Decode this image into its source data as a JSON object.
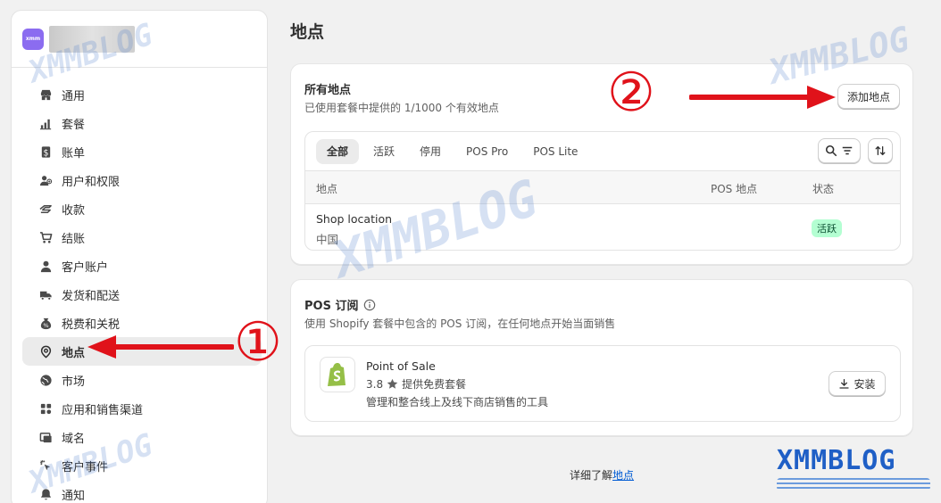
{
  "store": {
    "logo_text": "xmm"
  },
  "sidebar": {
    "items": [
      {
        "label": "通用",
        "icon": "store-icon"
      },
      {
        "label": "套餐",
        "icon": "plan-chart-icon"
      },
      {
        "label": "账单",
        "icon": "billing-icon"
      },
      {
        "label": "用户和权限",
        "icon": "users-icon"
      },
      {
        "label": "收款",
        "icon": "payments-icon"
      },
      {
        "label": "结账",
        "icon": "cart-icon"
      },
      {
        "label": "客户账户",
        "icon": "person-icon"
      },
      {
        "label": "发货和配送",
        "icon": "truck-icon"
      },
      {
        "label": "税费和关税",
        "icon": "tax-icon"
      },
      {
        "label": "地点",
        "icon": "location-pin-icon",
        "active": true
      },
      {
        "label": "市场",
        "icon": "globe-icon"
      },
      {
        "label": "应用和销售渠道",
        "icon": "apps-icon"
      },
      {
        "label": "域名",
        "icon": "domain-icon"
      },
      {
        "label": "客户事件",
        "icon": "cursor-icon"
      },
      {
        "label": "通知",
        "icon": "bell-icon"
      }
    ]
  },
  "page": {
    "title": "地点"
  },
  "locations_card": {
    "title": "所有地点",
    "subtitle": "已使用套餐中提供的 1/1000 个有效地点",
    "add_button": "添加地点",
    "tabs": [
      "全部",
      "活跃",
      "停用",
      "POS Pro",
      "POS Lite"
    ],
    "columns": [
      "地点",
      "POS 地点",
      "状态"
    ],
    "rows": [
      {
        "name": "Shop location",
        "country": "中国",
        "pos": "",
        "status": "活跃"
      }
    ]
  },
  "pos_card": {
    "title": "POS 订阅",
    "subtitle": "使用 Shopify 套餐中包含的 POS 订阅，在任何地点开始当面销售",
    "app": {
      "name": "Point of Sale",
      "rating": "3.8",
      "price": "提供免费套餐",
      "description": "管理和整合线上及线下商店销售的工具",
      "install_label": "安装"
    }
  },
  "footer": {
    "prefix": "详细了解",
    "link": "地点"
  },
  "annotations": {
    "marker_1": "①",
    "marker_2": "②",
    "arrow_color": "#e0121a"
  },
  "watermark": {
    "text": "XMMBLOG",
    "logo_text": "XMMBLOG"
  }
}
